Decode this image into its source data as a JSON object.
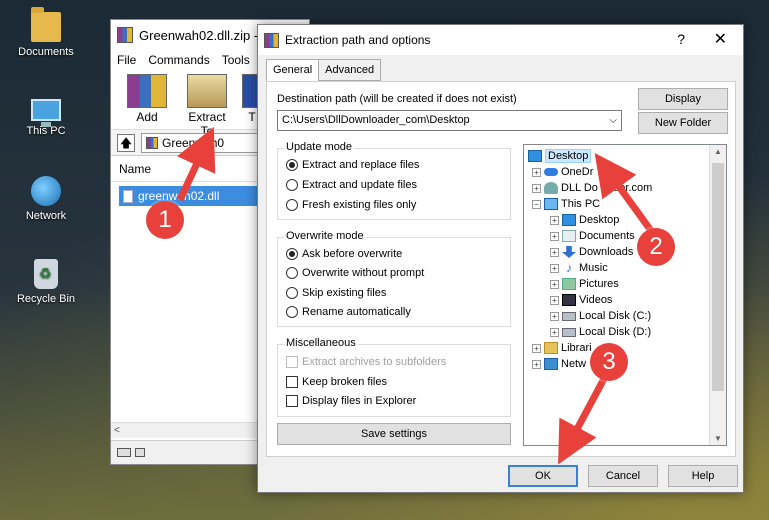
{
  "desktop": {
    "icons": [
      {
        "label": "Documents",
        "icon": "folder-icon"
      },
      {
        "label": "This PC",
        "icon": "computer-icon"
      },
      {
        "label": "Network",
        "icon": "network-icon"
      },
      {
        "label": "Recycle Bin",
        "icon": "recycle-bin-icon"
      }
    ]
  },
  "winrar": {
    "title": "Greenwah02.dll.zip -",
    "menu": [
      "File",
      "Commands",
      "Tools"
    ],
    "toolbar": {
      "add": "Add",
      "extract_to": "Extract To",
      "third": "T"
    },
    "address": "Greenwah0",
    "column_name": "Name",
    "file_name": "greenwah02.dll",
    "scroll_left": "<"
  },
  "dialog": {
    "title": "Extraction path and options",
    "help": "?",
    "close": "✕",
    "tabs": {
      "general": "General",
      "advanced": "Advanced"
    },
    "destination_label": "Destination path (will be created if does not exist)",
    "destination_value": "C:\\Users\\DllDownloader_com\\Desktop",
    "display_button": "Display",
    "new_folder_button": "New Folder",
    "update_mode": {
      "title": "Update mode",
      "options": [
        "Extract and replace files",
        "Extract and update files",
        "Fresh existing files only"
      ],
      "selected": 0
    },
    "overwrite_mode": {
      "title": "Overwrite mode",
      "options": [
        "Ask before overwrite",
        "Overwrite without prompt",
        "Skip existing files",
        "Rename automatically"
      ],
      "selected": 0
    },
    "misc": {
      "title": "Miscellaneous",
      "options": [
        "Extract archives to subfolders",
        "Keep broken files",
        "Display files in Explorer"
      ]
    },
    "save_settings": "Save settings",
    "tree": {
      "desktop": "Desktop",
      "onedrive": "OneDr",
      "dlldownloader": "DLL Do          nader.com",
      "this_pc": "This PC",
      "pc_desktop": "Desktop",
      "documents": "Documents",
      "downloads": "Downloads",
      "music": "Music",
      "pictures": "Pictures",
      "videos": "Videos",
      "local_c": "Local Disk (C:)",
      "local_d": "Local Disk (D:)",
      "libraries": "Librari",
      "network": "Netw"
    },
    "ok": "OK",
    "cancel": "Cancel",
    "help_button": "Help"
  },
  "annotations": {
    "step1": "1",
    "step2": "2",
    "step3": "3",
    "color": "#e8403a"
  }
}
